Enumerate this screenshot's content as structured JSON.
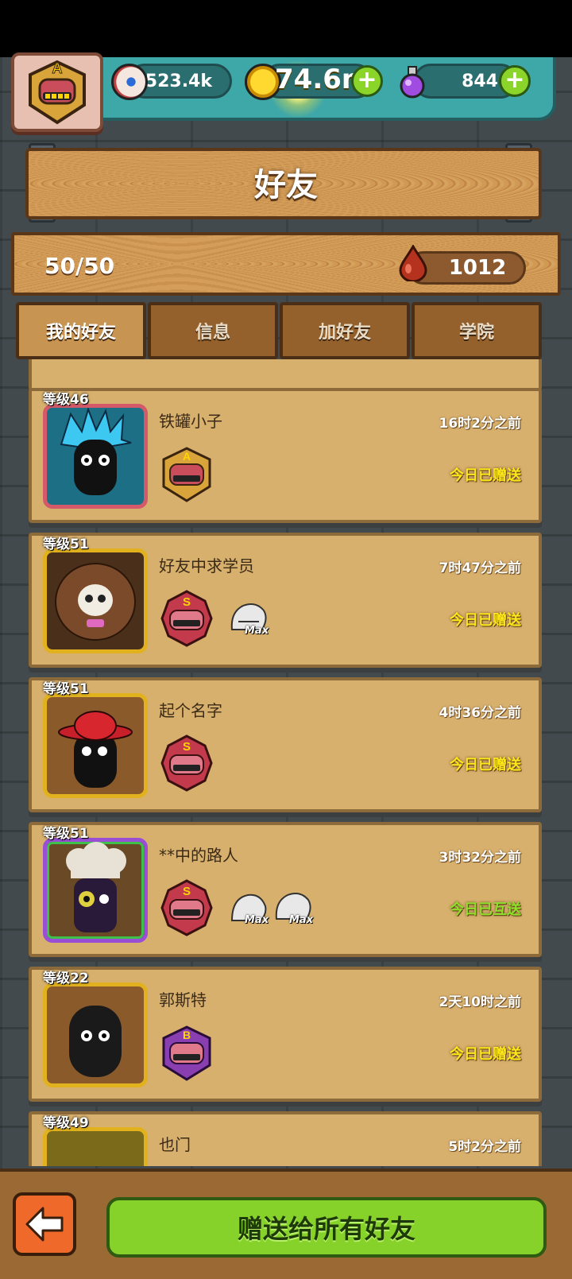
{
  "header": {
    "player_rank": "A",
    "eyes_value": "523.4k",
    "gold_value": "74.6m",
    "potion_value": "844",
    "plus_label": "+"
  },
  "title": "好友",
  "friends_count": "50/50",
  "blood_value": "1012",
  "tabs": [
    {
      "label": "我的好友",
      "active": true
    },
    {
      "label": "信息",
      "active": false
    },
    {
      "label": "加好友",
      "active": false
    },
    {
      "label": "学院",
      "active": false
    }
  ],
  "friends": [
    {
      "level": "等级46",
      "name": "铁罐小子",
      "time": "16时2分之前",
      "status": "今日已赠送",
      "rank": "A",
      "pets": []
    },
    {
      "level": "等级51",
      "name": "好友中求学员",
      "time": "7时47分之前",
      "status": "今日已赠送",
      "rank": "S",
      "pets": [
        "Max"
      ]
    },
    {
      "level": "等级51",
      "name": "起个名字",
      "time": "4时36分之前",
      "status": "今日已赠送",
      "rank": "S",
      "pets": []
    },
    {
      "level": "等级51",
      "name": "**中的路人",
      "time": "3时32分之前",
      "status": "今日已互送",
      "rank": "S",
      "pets": [
        "Max",
        "Max"
      ]
    },
    {
      "level": "等级22",
      "name": "郭斯特",
      "time": "2天10时之前",
      "status": "今日已赠送",
      "rank": "B",
      "pets": []
    },
    {
      "level": "等级49",
      "name": "也门",
      "time": "5时2分之前",
      "status": "",
      "rank": "",
      "pets": []
    }
  ],
  "send_all_label": "赠送给所有好友",
  "colors": {
    "status_gift": "#ffe81a",
    "status_mutual": "#8ee02a",
    "button_green": "#86d22a",
    "back_orange": "#ef6a2a"
  },
  "icons": {
    "back": "arrow-left-icon",
    "eye": "eyeball-icon",
    "gold": "gold-coin-icon",
    "potion": "potion-icon",
    "blood": "blood-drop-icon"
  }
}
